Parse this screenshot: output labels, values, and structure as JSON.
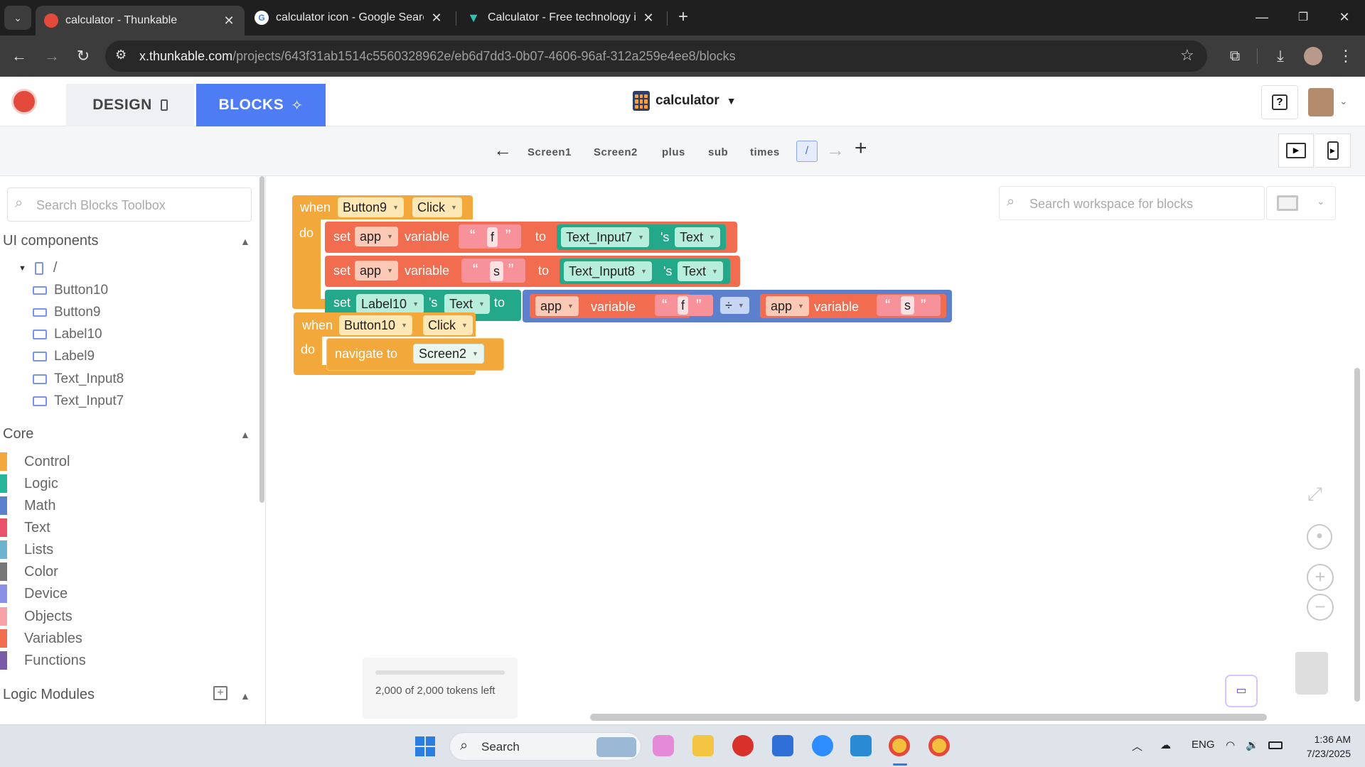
{
  "browser": {
    "tabs": [
      {
        "title": "calculator - Thunkable",
        "active": true
      },
      {
        "title": "calculator icon - Google Search",
        "active": false
      },
      {
        "title": "Calculator - Free technology ico",
        "active": false
      }
    ],
    "url_host": "x.thunkable.com",
    "url_path": "/projects/643f31ab1514c5560328962e/eb6d7dd3-0b07-4606-96af-312a259e4ee8/blocks"
  },
  "header": {
    "design_tab": "DESIGN",
    "blocks_tab": "BLOCKS",
    "project_name": "calculator",
    "help_label": "?"
  },
  "screens": {
    "items": [
      "Screen1",
      "Screen2",
      "plus",
      "sub",
      "times"
    ],
    "active": "/"
  },
  "toolbox": {
    "search_placeholder": "Search Blocks Toolbox",
    "ui_components_title": "UI components",
    "root_screen": "/",
    "components": [
      "Button10",
      "Button9",
      "Label10",
      "Label9",
      "Text_Input8",
      "Text_Input7"
    ],
    "core_title": "Core",
    "categories": [
      {
        "name": "Control",
        "color": "#f3a83b"
      },
      {
        "name": "Logic",
        "color": "#25b59a"
      },
      {
        "name": "Math",
        "color": "#5d80cd"
      },
      {
        "name": "Text",
        "color": "#e8536b"
      },
      {
        "name": "Lists",
        "color": "#6db3d0"
      },
      {
        "name": "Color",
        "color": "#777777"
      },
      {
        "name": "Device",
        "color": "#8b8fe6"
      },
      {
        "name": "Objects",
        "color": "#f7a2a8"
      },
      {
        "name": "Variables",
        "color": "#f26d50"
      },
      {
        "name": "Functions",
        "color": "#7a5ba8"
      }
    ],
    "logic_modules_title": "Logic Modules"
  },
  "workspace": {
    "search_placeholder": "Search workspace for blocks",
    "block1": {
      "when": "when",
      "component": "Button9",
      "event": "Click",
      "do": "do",
      "set": "set",
      "scope": "app",
      "variable": "variable",
      "to": "to",
      "apos_s": "'s",
      "row1_var": "f",
      "row1_comp": "Text_Input7",
      "row1_prop": "Text",
      "row2_var": "s",
      "row2_comp": "Text_Input8",
      "row2_prop": "Text",
      "row3_comp": "Label10",
      "row3_prop": "Text",
      "op": "÷",
      "op_left": "f",
      "op_right": "s",
      "quote_open": "“",
      "quote_close": "”"
    },
    "block2": {
      "when": "when",
      "component": "Button10",
      "event": "Click",
      "do": "do",
      "navigate": "navigate to",
      "target": "Screen2"
    },
    "tokens_text": "2,000 of 2,000 tokens left",
    "tokens_fraction": 1.0
  },
  "taskbar": {
    "search_label": "Search",
    "lang": "ENG",
    "time": "1:36 AM",
    "date": "7/23/2025"
  },
  "colors": {
    "accent": "#4d7cf5",
    "control": "#f3a83b",
    "variables": "#f26d50",
    "text": "#f7919a",
    "component": "#24a88a",
    "math": "#5d80cd"
  }
}
